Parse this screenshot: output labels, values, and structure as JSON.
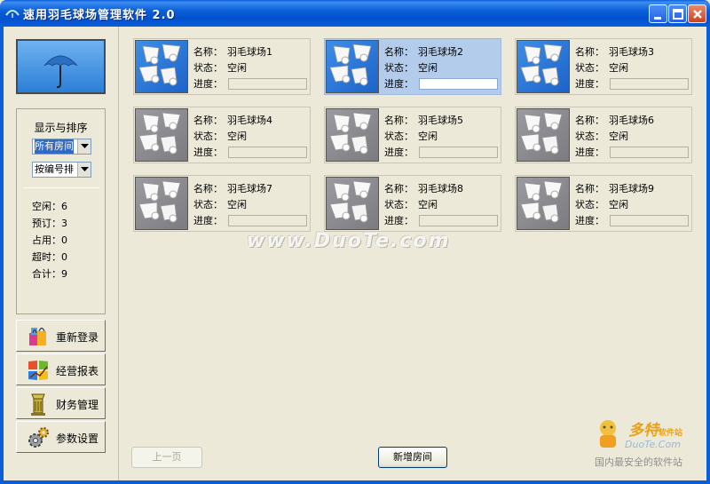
{
  "window": {
    "title": "速用羽毛球场管理软件 2.0",
    "accent": "#0a5fd8"
  },
  "sidebar": {
    "filter_title": "显示与排序",
    "room_filter": "所有房间",
    "sort_order": "按编号排",
    "stats": [
      {
        "label": "空闲：",
        "value": "6"
      },
      {
        "label": "预订：",
        "value": "3"
      },
      {
        "label": "占用：",
        "value": "0"
      },
      {
        "label": "超时：",
        "value": "0"
      },
      {
        "label": "合计：",
        "value": "9"
      }
    ],
    "buttons": [
      {
        "label": "重新登录",
        "icon": "gift-bag-icon"
      },
      {
        "label": "经营报表",
        "icon": "windows-chart-icon"
      },
      {
        "label": "财务管理",
        "icon": "money-tower-icon"
      },
      {
        "label": "参数设置",
        "icon": "gear-icon"
      }
    ]
  },
  "courts": [
    {
      "name_label": "名称：",
      "name": "羽毛球场1",
      "status_label": "状态：",
      "status": "空闲",
      "progress_label": "进度：",
      "progress": 0,
      "theme": "blue"
    },
    {
      "name_label": "名称：",
      "name": "羽毛球场2",
      "status_label": "状态：",
      "status": "空闲",
      "progress_label": "进度：",
      "progress": 0,
      "theme": "blue",
      "selected": true
    },
    {
      "name_label": "名称：",
      "name": "羽毛球场3",
      "status_label": "状态：",
      "status": "空闲",
      "progress_label": "进度：",
      "progress": 0,
      "theme": "blue"
    },
    {
      "name_label": "名称：",
      "name": "羽毛球场4",
      "status_label": "状态：",
      "status": "空闲",
      "progress_label": "进度：",
      "progress": 0,
      "theme": "gray"
    },
    {
      "name_label": "名称：",
      "name": "羽毛球场5",
      "status_label": "状态：",
      "status": "空闲",
      "progress_label": "进度：",
      "progress": 0,
      "theme": "gray"
    },
    {
      "name_label": "名称：",
      "name": "羽毛球场6",
      "status_label": "状态：",
      "status": "空闲",
      "progress_label": "进度：",
      "progress": 0,
      "theme": "gray"
    },
    {
      "name_label": "名称：",
      "name": "羽毛球场7",
      "status_label": "状态：",
      "status": "空闲",
      "progress_label": "进度：",
      "progress": 0,
      "theme": "gray"
    },
    {
      "name_label": "名称：",
      "name": "羽毛球场8",
      "status_label": "状态：",
      "status": "空闲",
      "progress_label": "进度：",
      "progress": 0,
      "theme": "gray"
    },
    {
      "name_label": "名称：",
      "name": "羽毛球场9",
      "status_label": "状态：",
      "status": "空闲",
      "progress_label": "进度：",
      "progress": 0,
      "theme": "gray"
    }
  ],
  "footer": {
    "prev_label": "上一页",
    "add_label": "新增房间"
  },
  "watermark": {
    "center": "www.DuoTe.com",
    "corner_line1": "多特",
    "corner_line1_small": "软件站",
    "corner_line2": "DuoTe.Com",
    "corner_line3": "国内最安全的软件站"
  }
}
